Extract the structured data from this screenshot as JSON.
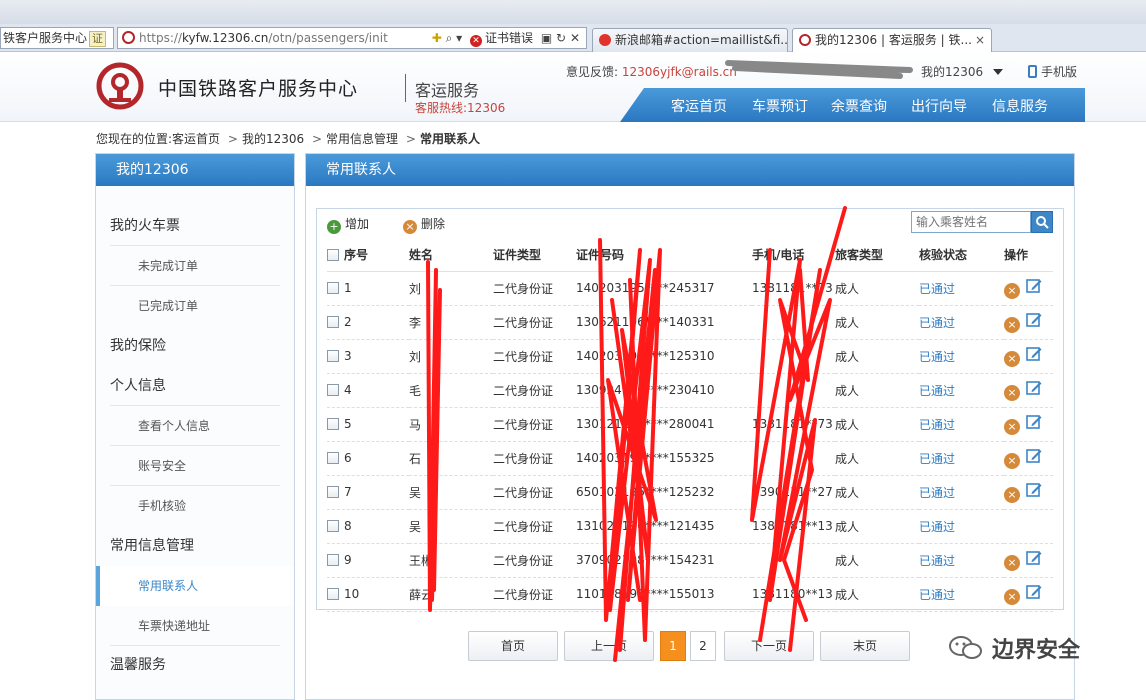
{
  "browser": {
    "left_address": "铁客户服务中心",
    "left_address_tag": "证",
    "url_prefix": "https://",
    "url_host": "kyfw.12306.cn",
    "url_path": "/otn/passengers/init",
    "cert_error": "证书错误",
    "tabs": [
      {
        "label": "新浪邮箱#action=maillist&fi..."
      },
      {
        "label": "我的12306 | 客运服务 | 铁..."
      }
    ],
    "tab_close": "×"
  },
  "header": {
    "site_name": "中国铁路客户服务中心",
    "sub_name": "客运服务",
    "hotline": "客服热线:12306",
    "feedback_label": "意见反馈:",
    "feedback_mail": "12306yjfk@rails.cn",
    "my_account": "我的12306",
    "mobile": "手机版",
    "nav": [
      "客运首页",
      "车票预订",
      "余票查询",
      "出行向导",
      "信息服务"
    ]
  },
  "breadcrumb": {
    "prefix": "您现在的位置:",
    "items": [
      "客运首页",
      "我的12306",
      "常用信息管理"
    ],
    "current": "常用联系人",
    "separator": ">"
  },
  "sidebar": {
    "title": "我的12306",
    "items": [
      {
        "label": "我的火车票"
      },
      {
        "label": "未完成订单"
      },
      {
        "label": "已完成订单"
      },
      {
        "label": "我的保险"
      },
      {
        "label": "个人信息"
      },
      {
        "label": "查看个人信息"
      },
      {
        "label": "账号安全"
      },
      {
        "label": "手机核验"
      },
      {
        "label": "常用信息管理"
      },
      {
        "label": "常用联系人"
      },
      {
        "label": "车票快递地址"
      },
      {
        "label": "温馨服务"
      }
    ]
  },
  "panel": {
    "title": "常用联系人",
    "add_label": "增加",
    "delete_label": "删除",
    "search_placeholder": "输入乘客姓名",
    "columns": [
      "序号",
      "姓名",
      "证件类型",
      "证件号码",
      "手机/电话",
      "旅客类型",
      "核验状态",
      "操作"
    ],
    "rows": [
      {
        "no": "1",
        "name": "刘",
        "id_type": "二代身份证",
        "id_no": "140203195****245317",
        "phone": "1381181**73",
        "ptype": "成人",
        "status": "已通过"
      },
      {
        "no": "2",
        "name": "李",
        "id_type": "二代身份证",
        "id_no": "130621196****140331",
        "phone": "",
        "ptype": "成人",
        "status": "已通过"
      },
      {
        "no": "3",
        "name": "刘",
        "id_type": "二代身份证",
        "id_no": "140203195****125310",
        "phone": "",
        "ptype": "成人",
        "status": "已通过"
      },
      {
        "no": "4",
        "name": "毛",
        "id_type": "二代身份证",
        "id_no": "130924196****230410",
        "phone": "",
        "ptype": "成人",
        "status": "已通过"
      },
      {
        "no": "5",
        "name": "马",
        "id_type": "二代身份证",
        "id_no": "130121197****280041",
        "phone": "1381181**73",
        "ptype": "成人",
        "status": "已通过"
      },
      {
        "no": "6",
        "name": "石",
        "id_type": "二代身份证",
        "id_no": "140203197****155325",
        "phone": "",
        "ptype": "成人",
        "status": "已通过"
      },
      {
        "no": "7",
        "name": "吴",
        "id_type": "二代身份证",
        "id_no": "650102196****125232",
        "phone": "1390131**27",
        "ptype": "成人",
        "status": "已通过"
      },
      {
        "no": "8",
        "name": "吴",
        "id_type": "二代身份证",
        "id_no": "131023196****121435",
        "phone": "1381181**13",
        "ptype": "成人",
        "status": "已通过"
      },
      {
        "no": "9",
        "name": "王彬",
        "id_type": "二代身份证",
        "id_no": "370902198****154231",
        "phone": "",
        "ptype": "成人",
        "status": "已通过"
      },
      {
        "no": "10",
        "name": "薛云",
        "id_type": "二代身份证",
        "id_no": "110108196****155013",
        "phone": "1381180**13",
        "ptype": "成人",
        "status": "已通过"
      }
    ]
  },
  "pager": {
    "first": "首页",
    "prev": "上一页",
    "pages": [
      "1",
      "2"
    ],
    "current": "1",
    "next": "下一页",
    "last": "末页"
  },
  "watermark": {
    "text": "边界安全"
  },
  "colors": {
    "accent_blue": "#2b78c1",
    "hotline_red": "#c8453d",
    "verified_blue": "#2f7cc3",
    "pager_current": "#f5901e",
    "redaction_red": "#ff1a1a"
  }
}
